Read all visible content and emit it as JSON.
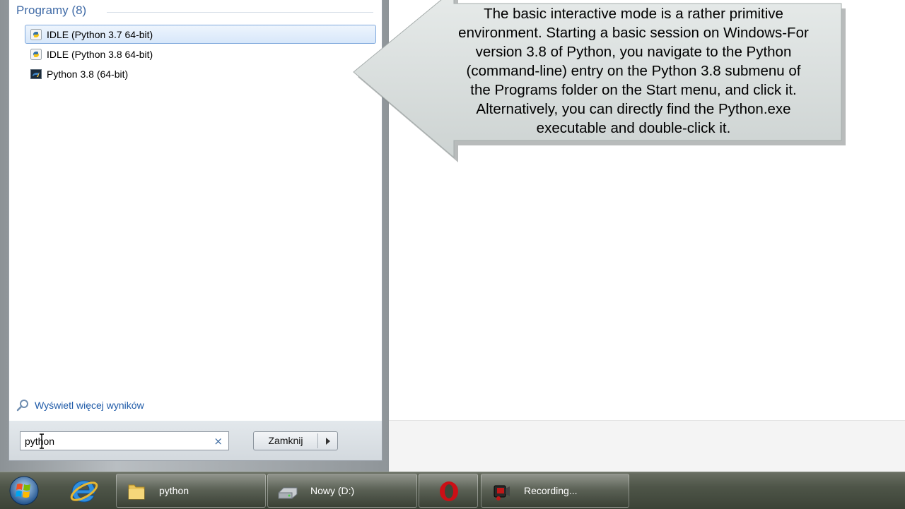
{
  "start_menu": {
    "section_title": "Programy (8)",
    "items": [
      {
        "label": "IDLE (Python 3.7 64-bit)",
        "selected": true
      },
      {
        "label": "IDLE (Python 3.8 64-bit)",
        "selected": false
      },
      {
        "label": "Python 3.8 (64-bit)",
        "selected": false
      }
    ],
    "more_results": "Wyświetl więcej wyników",
    "search_value": "python",
    "clear_symbol": "×",
    "shutdown_label": "Zamknij"
  },
  "callout": {
    "text": "The basic interactive mode is a rather primitive\nenvironment. Starting a basic session on Windows-For\nversion 3.8 of Python, you navigate to the Python\n(command-line) entry on the Python 3.8 submenu of\nthe Programs folder on the Start menu, and click it.\nAlternatively, you can directly find the Python.exe\nexecutable and double-click it."
  },
  "taskbar": {
    "pinned": [
      {
        "icon": "windows-start-orb-icon"
      },
      {
        "icon": "internet-explorer-icon"
      }
    ],
    "buttons": [
      {
        "label": "python",
        "icon": "folder-icon"
      },
      {
        "label": "Nowy (D:)",
        "icon": "drive-icon"
      },
      {
        "label": "",
        "icon": "opera-icon"
      },
      {
        "label": "Recording...",
        "icon": "camcorder-icon"
      }
    ]
  },
  "colors": {
    "accent_blue": "#3f6aa6",
    "selection_border": "#7ea8dc",
    "callout_fill": "#d9dedd"
  }
}
